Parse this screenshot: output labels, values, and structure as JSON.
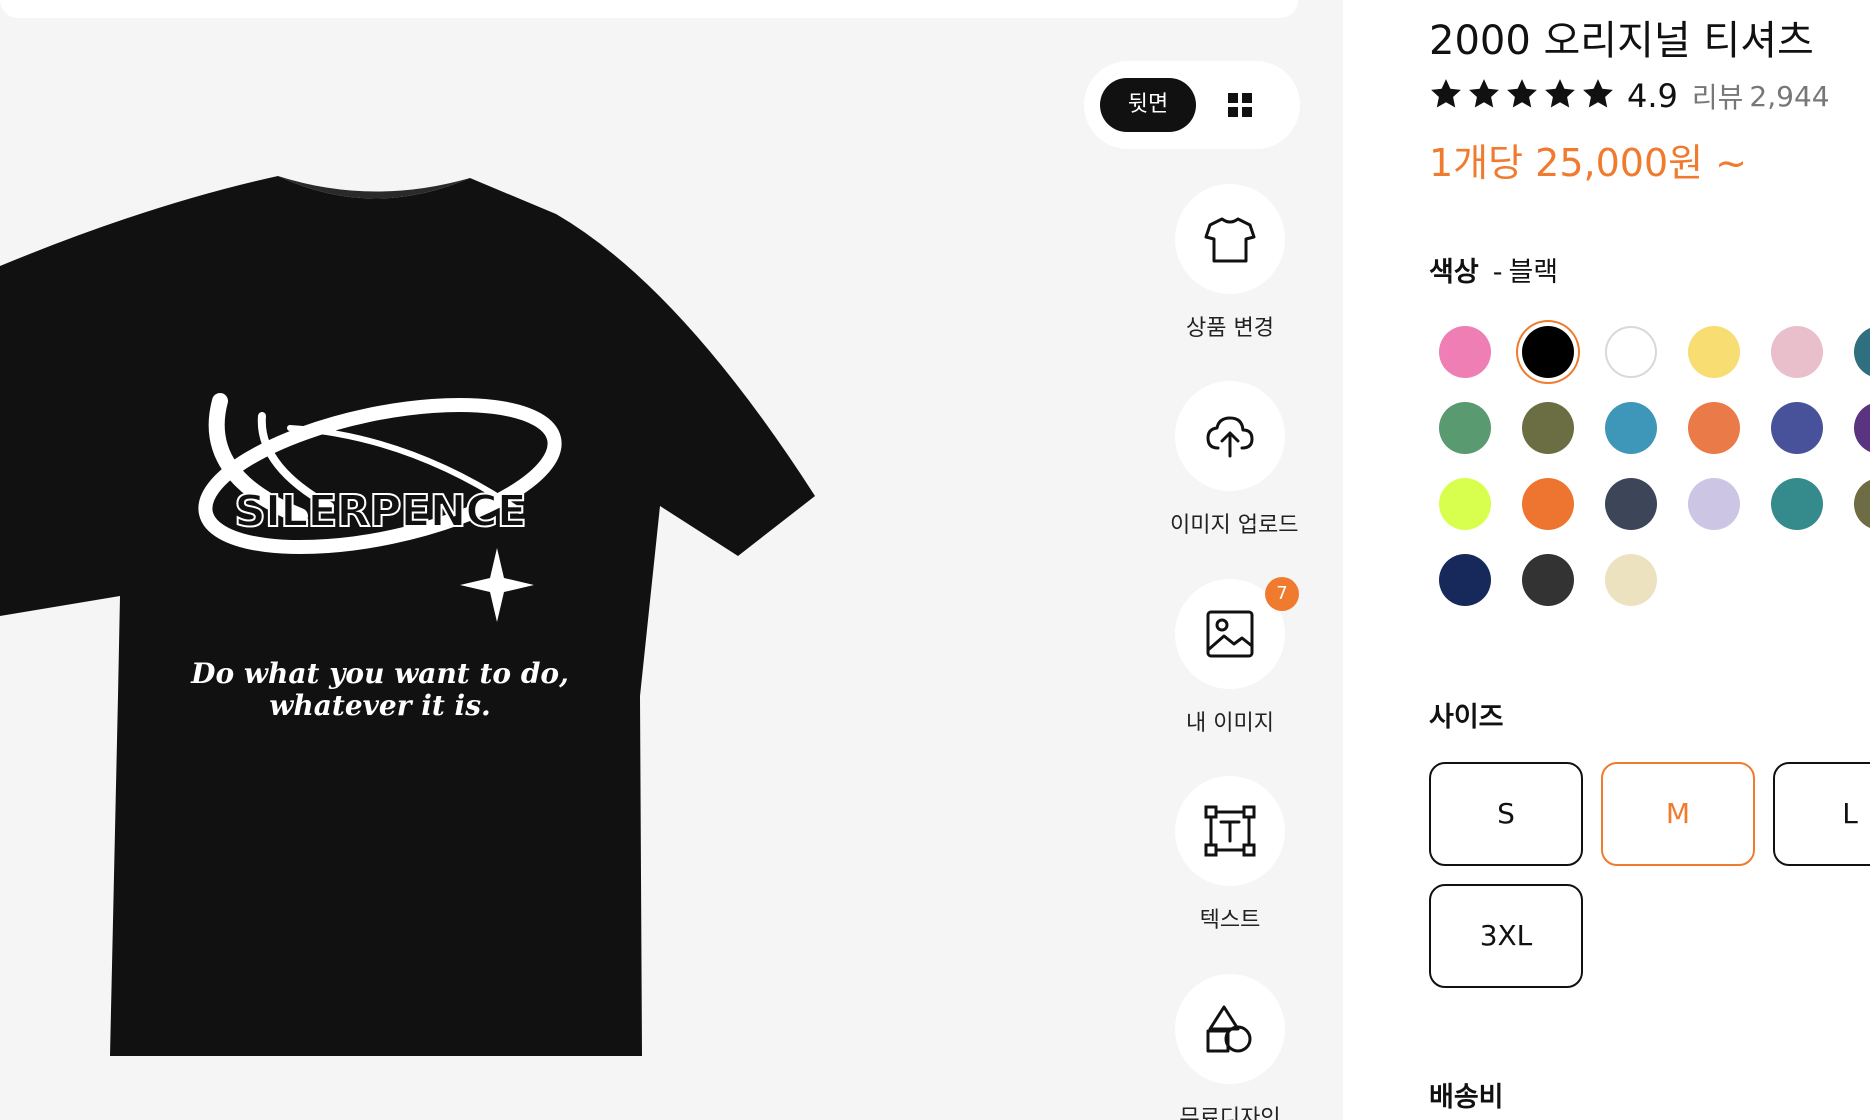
{
  "product": {
    "title": "2000 오리지널 티셔츠",
    "rating": "4.9",
    "rating_stars": 5,
    "review_label": "리뷰",
    "review_count": "2,944",
    "price": "1개당 25,000원 ~"
  },
  "view_toggle": {
    "back_label": "뒷면",
    "grid_icon": "grid-icon"
  },
  "tools": [
    {
      "label": "상품 변경",
      "icon": "tshirt-icon"
    },
    {
      "label": "이미지 업로드",
      "icon": "cloud-upload-icon"
    },
    {
      "label": "내 이미지",
      "icon": "image-icon",
      "badge": "7"
    },
    {
      "label": "텍스트",
      "icon": "text-box-icon"
    },
    {
      "label": "무료디자인",
      "icon": "shapes-icon"
    }
  ],
  "design": {
    "brand_text": "SILERPENCE",
    "slogan_line1": "Do what you want to do,",
    "slogan_line2": "whatever it is."
  },
  "color": {
    "heading": "색상",
    "separator": "-",
    "selected_name": "블랙",
    "swatches": [
      "#ee7eb4",
      "#000000",
      "#ffffff",
      "#f8dd72",
      "#e8bfca",
      "#2f6f80",
      "#5a9a70",
      "#6a6e42",
      "#3e97b8",
      "#ea7a48",
      "#47529b",
      "#5a3480",
      "#d9ff4e",
      "#ee7530",
      "#3c4658",
      "#ccc5e3",
      "#358b8b",
      "#6d6c45",
      "#17295a",
      "#333333",
      "#ede2bf"
    ],
    "selected_index": 1
  },
  "size": {
    "heading": "사이즈",
    "options": [
      "S",
      "M",
      "L",
      "3XL"
    ],
    "selected": "M"
  },
  "shipping": {
    "heading": "배송비"
  },
  "colors": {
    "accent": "#f07b2e",
    "canvas_bg": "#f5f5f5",
    "shirt": "#111111"
  }
}
